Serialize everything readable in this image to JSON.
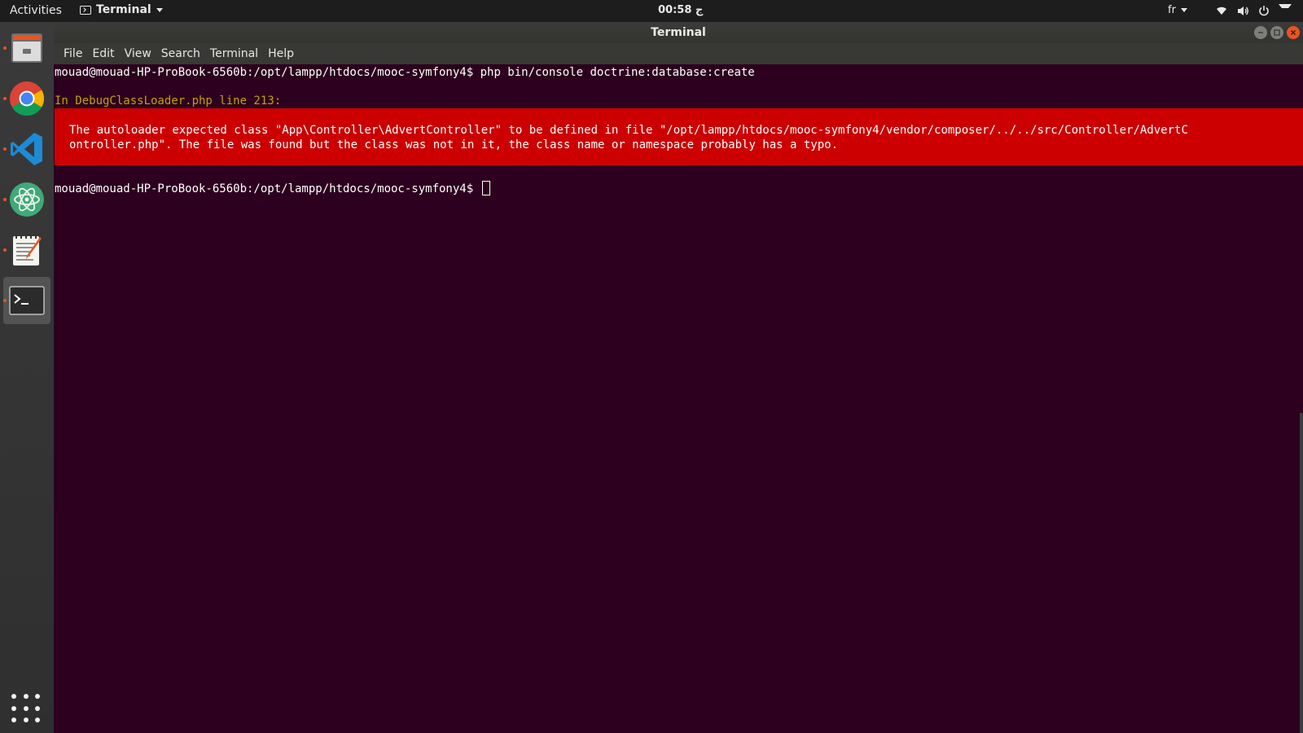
{
  "topbar": {
    "activities": "Activities",
    "app_name": "Terminal",
    "clock": "00:58 ج",
    "lang": "fr"
  },
  "dock": {
    "items": [
      "Files",
      "Google Chrome",
      "Visual Studio Code",
      "Atom",
      "Text Editor",
      "Terminal"
    ]
  },
  "window": {
    "title": "Terminal",
    "menu": [
      "File",
      "Edit",
      "View",
      "Search",
      "Terminal",
      "Help"
    ]
  },
  "terminal": {
    "prompt1": "mouad@mouad-HP-ProBook-6560b:/opt/lampp/htdocs/mooc-symfony4$ php bin/console doctrine:database:create",
    "error_header": "In DebugClassLoader.php line 213:",
    "error_line1": "The autoloader expected class \"App\\Controller\\AdvertController\" to be defined in file \"/opt/lampp/htdocs/mooc-symfony4/vendor/composer/../../src/Controller/AdvertC",
    "error_line2": "ontroller.php\". The file was found but the class was not in it, the class name or namespace probably has a typo.",
    "prompt2": "mouad@mouad-HP-ProBook-6560b:/opt/lampp/htdocs/mooc-symfony4$ "
  },
  "colors": {
    "terminal_bg": "#2c001e",
    "error_bg": "#cc0000",
    "error_header": "#c4a000",
    "accent": "#e95420"
  }
}
